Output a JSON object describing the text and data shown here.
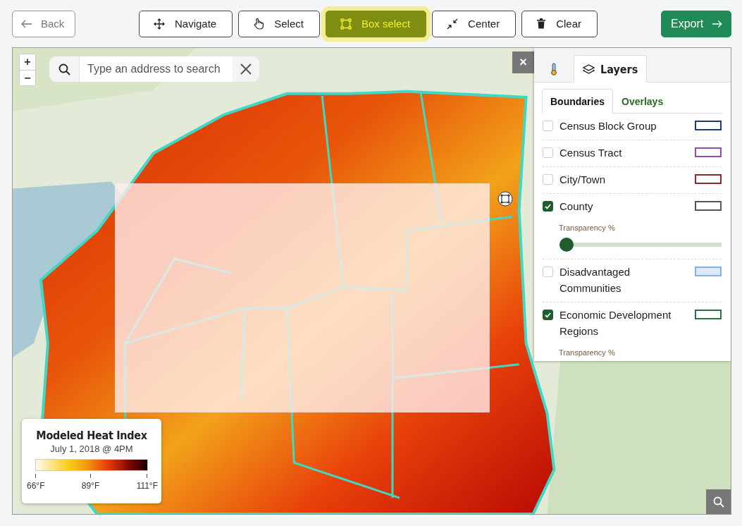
{
  "toolbar": {
    "back": "Back",
    "tools": [
      {
        "label": "Navigate",
        "kind": "move",
        "selected": false
      },
      {
        "label": "Select",
        "kind": "pointer",
        "selected": false
      },
      {
        "label": "Box select",
        "kind": "box",
        "selected": true
      },
      {
        "label": "Center",
        "kind": "center",
        "selected": false
      },
      {
        "label": "Clear",
        "kind": "clear",
        "selected": false
      }
    ],
    "export": "Export"
  },
  "map": {
    "zoom_in": "+",
    "zoom_out": "−",
    "search": {
      "placeholder": "Type an address to search"
    },
    "close_panel": "×",
    "panel": {
      "tabs": [
        {
          "kind": "thermometer",
          "selected": false
        },
        {
          "kind": "layers",
          "label": "Layers",
          "selected": true
        }
      ],
      "subtabs": [
        {
          "label": "Boundaries",
          "selected": true
        },
        {
          "label": "Overlays",
          "selected": false
        }
      ],
      "layers": [
        {
          "name": "Census Block Group",
          "checked": false,
          "color": "#1f3a7a"
        },
        {
          "name": "Census Tract",
          "checked": false,
          "color": "#8a4fb0"
        },
        {
          "name": "City/Town",
          "checked": false,
          "color": "#8c2a2a"
        },
        {
          "name": "County",
          "checked": true,
          "color": "#555555",
          "transparency": {
            "label": "Transparency %",
            "level": 0
          }
        },
        {
          "name": "Disadvantaged Communities",
          "checked": false,
          "color": "#7fb3e8"
        },
        {
          "name": "Economic Development Regions",
          "checked": true,
          "color": "#2e7044",
          "transparency": {
            "label": "Transparency %"
          }
        }
      ]
    },
    "legend": {
      "title": "Modeled Heat Index",
      "subtitle": "July 1, 2018 @ 4PM",
      "ticks": [
        "66°F",
        "89°F",
        "111°F"
      ]
    }
  }
}
